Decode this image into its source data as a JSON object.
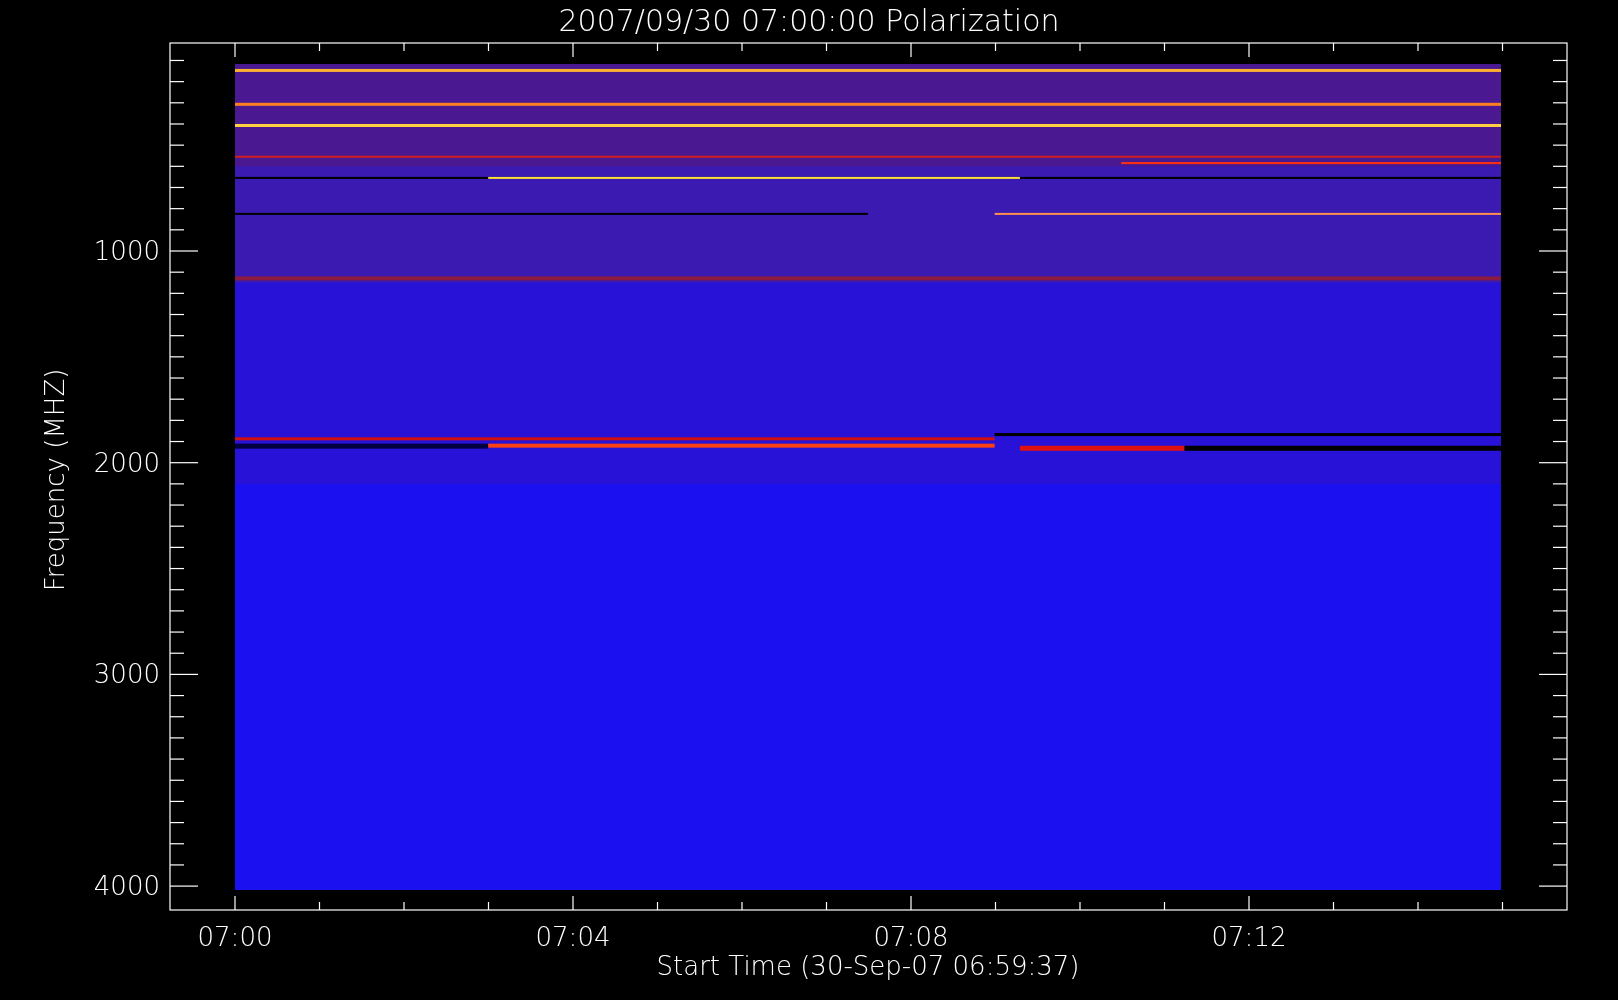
{
  "title": "2007/09/30 07:00:00 Polarization",
  "xlabel": "Start Time (30-Sep-07 06:59:37)",
  "ylabel": "Frequency (MHZ)",
  "x_tick_labels": [
    "07:00",
    "07:04",
    "07:08",
    "07:12"
  ],
  "y_tick_labels": [
    "1000",
    "2000",
    "3000",
    "4000"
  ]
}
